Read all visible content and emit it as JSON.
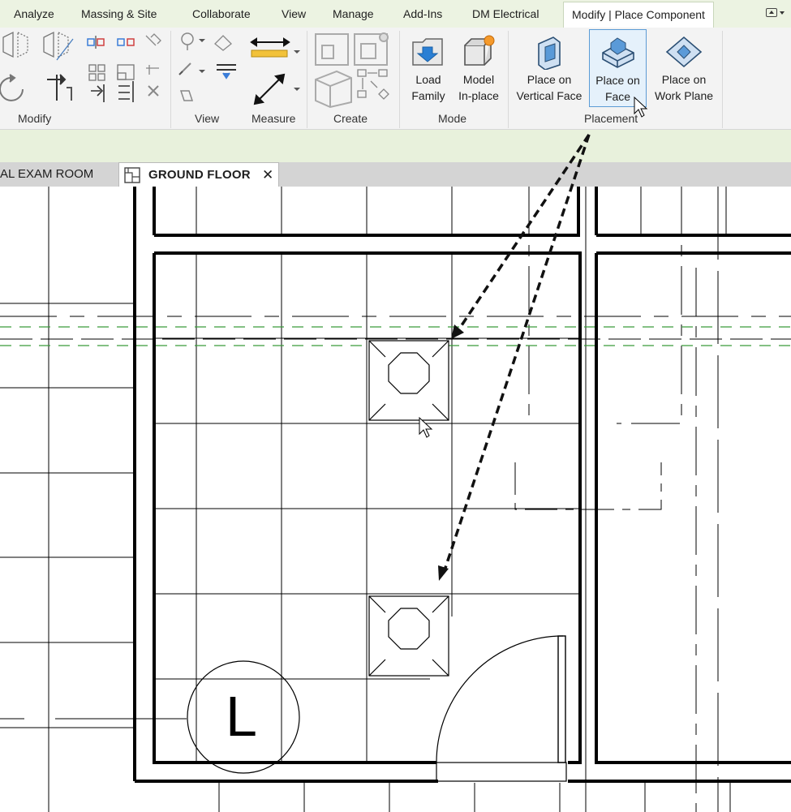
{
  "ribbon_tabs": {
    "analyze": "Analyze",
    "massing": "Massing & Site",
    "collaborate": "Collaborate",
    "view": "View",
    "manage": "Manage",
    "addins": "Add-Ins",
    "dm_electrical": "DM Electrical",
    "context": "Modify | Place Component"
  },
  "panels": {
    "modify": "Modify",
    "view": "View",
    "measure": "Measure",
    "create": "Create",
    "mode": "Mode",
    "placement": "Placement"
  },
  "mode_buttons": {
    "load_family": [
      "Load",
      "Family"
    ],
    "model_inplace": [
      "Model",
      "In-place"
    ]
  },
  "placement_buttons": {
    "vertical_face": [
      "Place on",
      "Vertical Face"
    ],
    "face": [
      "Place on",
      "Face"
    ],
    "work_plane": [
      "Place on",
      "Work Plane"
    ]
  },
  "placement_selected": "face",
  "view_tabs": {
    "inactive": "AL EXAM ROOM",
    "active": "GROUND FLOOR",
    "close_glyph": "✕"
  },
  "plan": {
    "room_tag": "L"
  },
  "colors": {
    "ribbon_tab_bg": "#ecf3e2",
    "ribbon_bg": "#f3f3f3",
    "selected_button": "#5b9bd5",
    "ref_plane": "#3a9a3a",
    "annotation_arrow": "#111111"
  }
}
